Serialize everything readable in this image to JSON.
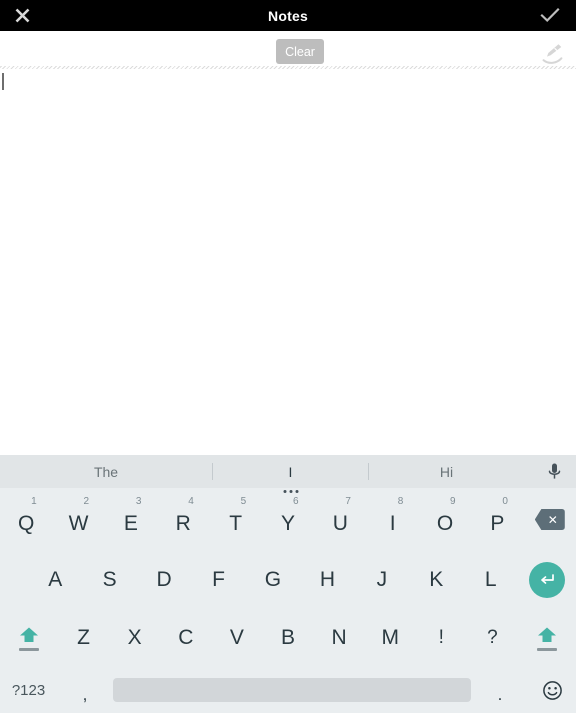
{
  "titlebar": {
    "close_icon": "close-x-icon",
    "title": "Notes",
    "confirm_icon": "checkmark-icon"
  },
  "actionbar": {
    "clear_label": "Clear",
    "pen_icon": "handwriting-pen-icon"
  },
  "note": {
    "text": "",
    "caret_visible": true
  },
  "keyboard": {
    "suggestions": [
      {
        "label": "The",
        "selected": false
      },
      {
        "label": "I",
        "selected": true
      },
      {
        "label": "Hi",
        "selected": false
      }
    ],
    "mic_icon": "microphone-icon",
    "row1": [
      {
        "letter": "Q",
        "num": "1"
      },
      {
        "letter": "W",
        "num": "2"
      },
      {
        "letter": "E",
        "num": "3"
      },
      {
        "letter": "R",
        "num": "4"
      },
      {
        "letter": "T",
        "num": "5"
      },
      {
        "letter": "Y",
        "num": "6"
      },
      {
        "letter": "U",
        "num": "7"
      },
      {
        "letter": "I",
        "num": "8"
      },
      {
        "letter": "O",
        "num": "9"
      },
      {
        "letter": "P",
        "num": "0"
      }
    ],
    "backspace_icon": "backspace-icon",
    "backspace_glyph": "✕",
    "row2": [
      "A",
      "S",
      "D",
      "F",
      "G",
      "H",
      "J",
      "K",
      "L"
    ],
    "enter_icon": "enter-return-icon",
    "enter_glyph": "↵",
    "row3": [
      "Z",
      "X",
      "C",
      "V",
      "B",
      "N",
      "M",
      "!",
      "?"
    ],
    "shift_left_icon": "shift-icon",
    "shift_right_icon": "shift-icon",
    "symbols_label": "?123",
    "comma_label": ",",
    "space_label": "",
    "period_label": ".",
    "emoji_icon": "emoji-smiley-icon",
    "emoji_glyph": "☺"
  },
  "colors": {
    "titlebar_bg": "#000000",
    "keyboard_bg": "#eaeef0",
    "suggestion_bg": "#e1e5e7",
    "accent_teal": "#45b3a5",
    "key_text": "#2b3a41",
    "backspace_bg": "#5d6e78",
    "spacebar_bg": "#d2d6d9",
    "clear_bg": "#bdbdbd"
  }
}
